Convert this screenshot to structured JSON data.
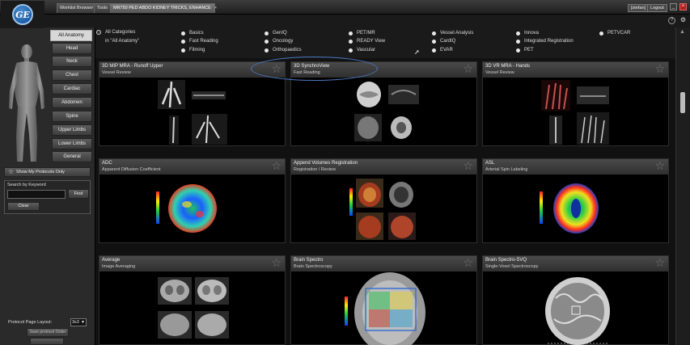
{
  "app": {
    "logo_text": "GE",
    "tabs": [
      {
        "label": "Worklist Browser"
      },
      {
        "label": "Tools"
      },
      {
        "label": "MR750 PED ABDO KIDNEY TRICKS, ENHANCE"
      }
    ],
    "user_label": "[stefan]",
    "logout_label": "Logout",
    "window_controls": [
      "_",
      "×"
    ]
  },
  "anatomy": {
    "all_label": "All Anatomy",
    "items": [
      "Head",
      "Neck",
      "Chest",
      "Cardiac",
      "Abdomen",
      "Spine",
      "Upper Limbs",
      "Lower Limbs",
      "General"
    ]
  },
  "left_panel": {
    "show_my_protocols": "Show My Protocols Only",
    "keyword_label": "Search by Keyword",
    "keyword_value": "",
    "find_label": "Find",
    "clear_label": "Clear",
    "layout_label": "Protocol Page Layout",
    "layout_value": "3x3",
    "save_order_label": "Save protocol Order"
  },
  "categories": {
    "all_label": "All Categories",
    "all_sub": "in \"All Anatomy\"",
    "items": [
      "Basics",
      "Fast Reading",
      "Filming",
      "GenIQ",
      "Oncology",
      "Orthopaedics",
      "PET/MR",
      "READY View",
      "Vascular",
      "Vessel Analysis",
      "CardIQ",
      "EVAR",
      "Innova",
      "Integrated Registration",
      "PET",
      "PETVCAR"
    ]
  },
  "protocols": [
    {
      "title": "3D MIP MRA - Runoff Upper",
      "subtitle": "Vessel Review"
    },
    {
      "title": "3D SynchroView",
      "subtitle": "Fast Reading"
    },
    {
      "title": "3D VR MRA - Hands",
      "subtitle": "Vessel Review"
    },
    {
      "title": "ADC",
      "subtitle": "Apparent Diffusion Coefficient"
    },
    {
      "title": "Append Volumes Registration",
      "subtitle": "Registration / Review"
    },
    {
      "title": "ASL",
      "subtitle": "Arterial Spin Labeling"
    },
    {
      "title": "Average",
      "subtitle": "Image Averaging"
    },
    {
      "title": "Brain Spectro",
      "subtitle": "Brain Spectroscopy"
    },
    {
      "title": "Brain Spectro-SVQ",
      "subtitle": "Single-Voxel Spectroscopy"
    }
  ],
  "icons": {
    "star": "☆",
    "help": "?",
    "settings": "⚙"
  },
  "colors": {
    "highlight": "#4a78c0",
    "logo_blue": "#1b5ea8"
  }
}
